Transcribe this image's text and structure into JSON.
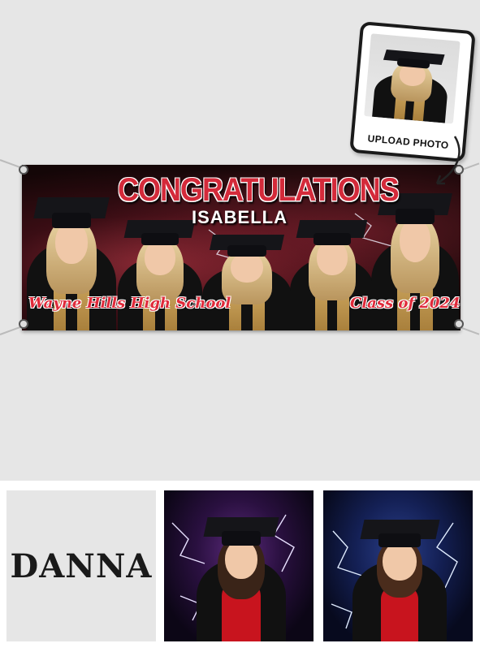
{
  "banner": {
    "headline": "CONGRATULATIONS",
    "name": "ISABELLA",
    "school": "Wayne Hills High School",
    "class_year": "Class of 2024",
    "accent_color": "#d42a3a"
  },
  "upload_card": {
    "label": "UPLOAD PHOTO",
    "icon": "arrow-icon"
  },
  "thumbnails": [
    {
      "kind": "font-sample",
      "text": "DANNA"
    },
    {
      "kind": "background-style",
      "theme": "purple-lightning"
    },
    {
      "kind": "background-style",
      "theme": "blue-lightning"
    }
  ]
}
